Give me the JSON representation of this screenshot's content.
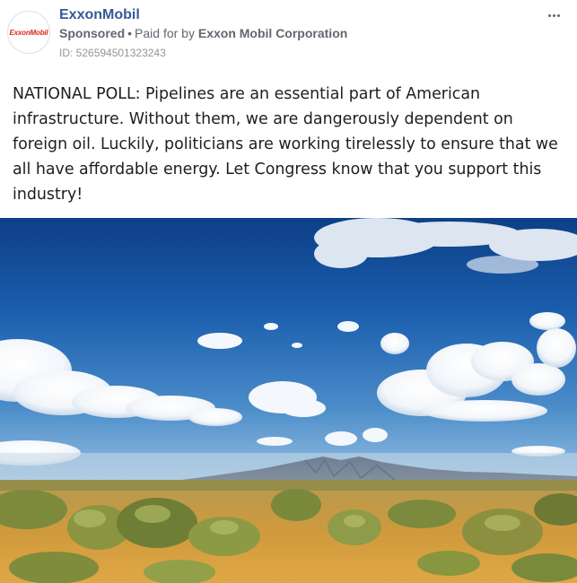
{
  "advertiser": {
    "name": "ExxonMobil",
    "logo_text": "ExxonMobil"
  },
  "meta": {
    "sponsored_label": "Sponsored",
    "separator": "•",
    "paid_for_prefix": "Paid for by",
    "paid_for_by": "Exxon Mobil Corporation",
    "ad_id": "ID: 526594501323243"
  },
  "post": {
    "message": "NATIONAL POLL: Pipelines are an essential part of American infrastructure. Without them, we are dangerously dependent on foreign oil. Luckily, politicians are working tirelessly to ensure that we all have affordable energy. Let Congress know that you support this industry!"
  },
  "image": {
    "subject": "desert landscape with blue sky, clouds, distant mountains and sagebrush"
  },
  "icons": {
    "more": "more-horizontal-icon"
  },
  "colors": {
    "page_name": "#385898",
    "meta_text": "#616770",
    "body_text": "#1c1e21",
    "logo_red": "#e1261c"
  }
}
